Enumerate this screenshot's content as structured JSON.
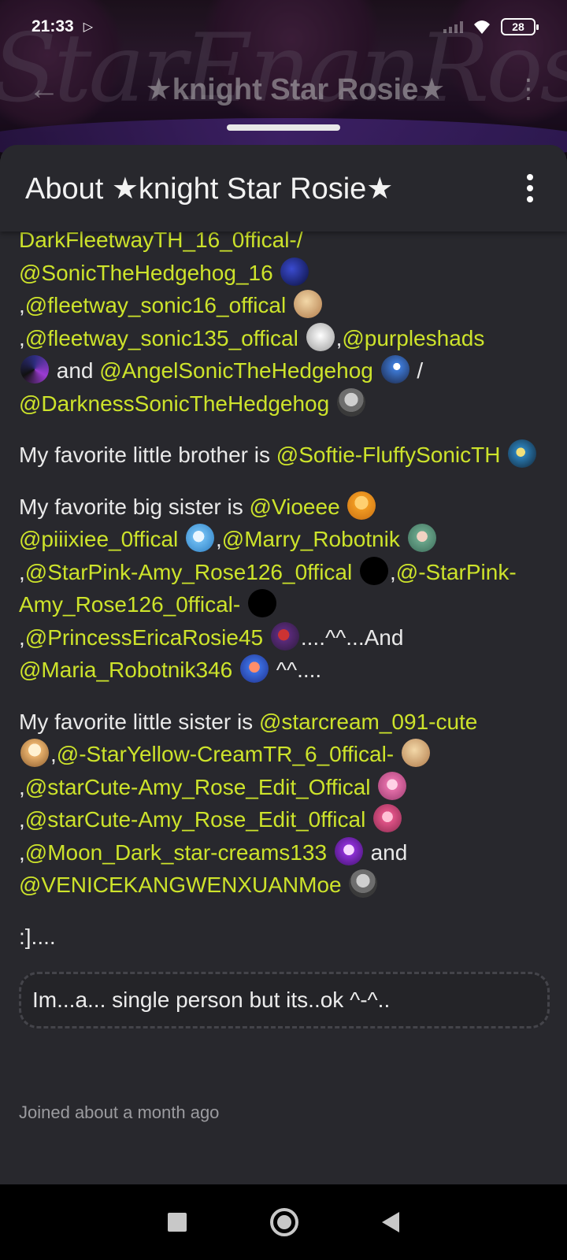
{
  "status_bar": {
    "time": "21:33",
    "battery": "28"
  },
  "top_bar": {
    "title": "★knight Star Rosie★",
    "banner_text": "StarEnanRose"
  },
  "sheet": {
    "title": "About ★knight Star Rosie★"
  },
  "bio": {
    "p1": {
      "l1": "DarkFleetwayTH_16_0ffical-/",
      "m1": "@SonicTheHedgehog_16",
      "c1": ",",
      "m2": "@fleetway_sonic16_offical",
      "c2": ",",
      "m3": "@fleetway_sonic135_offical",
      "c3": ",",
      "m4": "@purpleshads",
      "and": " and ",
      "m5": "@AngelSonicTheHedgehog",
      "slash": " /",
      "m6": "@DarknessSonicTheHedgehog"
    },
    "p2": {
      "text": "My favorite little brother is ",
      "m1": "@Softie-FluffySonicTH"
    },
    "p3": {
      "text": "My favorite big sister is ",
      "m1": "@Vioeee",
      "m2": "@piiixiee_0ffical",
      "c1": ",",
      "m3": "@Marry_Robotnik",
      "c2": ",",
      "m4": "@StarPink-Amy_Rose126_0ffical",
      "c3": ",",
      "m5": "@-StarPink-Amy_Rose126_0ffical-",
      "c4": ",",
      "m6": "@PrincessEricaRosie45",
      "mid": "....^^...And",
      "m7": "@Maria_Robotnik346",
      "end": " ^^...."
    },
    "p4": {
      "text": "My favorite little sister is ",
      "m1": "@starcream_091-cute",
      "c1": ",",
      "m2": "@-StarYellow-CreamTR_6_0ffical-",
      "c2": ",",
      "m3": "@starCute-Amy_Rose_Edit_Offical",
      "c3": ",",
      "m4": "@starCute-Amy_Rose_Edit_0ffical",
      "c4": ",",
      "m5": "@Moon_Dark_star-creams133",
      "and": " and",
      "m6": "@VENICEKANGWENXUANMoe"
    },
    "p5": ":]....",
    "quote": "Im...a... single person but its..ok ^-^..",
    "joined": "Joined about a month ago"
  }
}
